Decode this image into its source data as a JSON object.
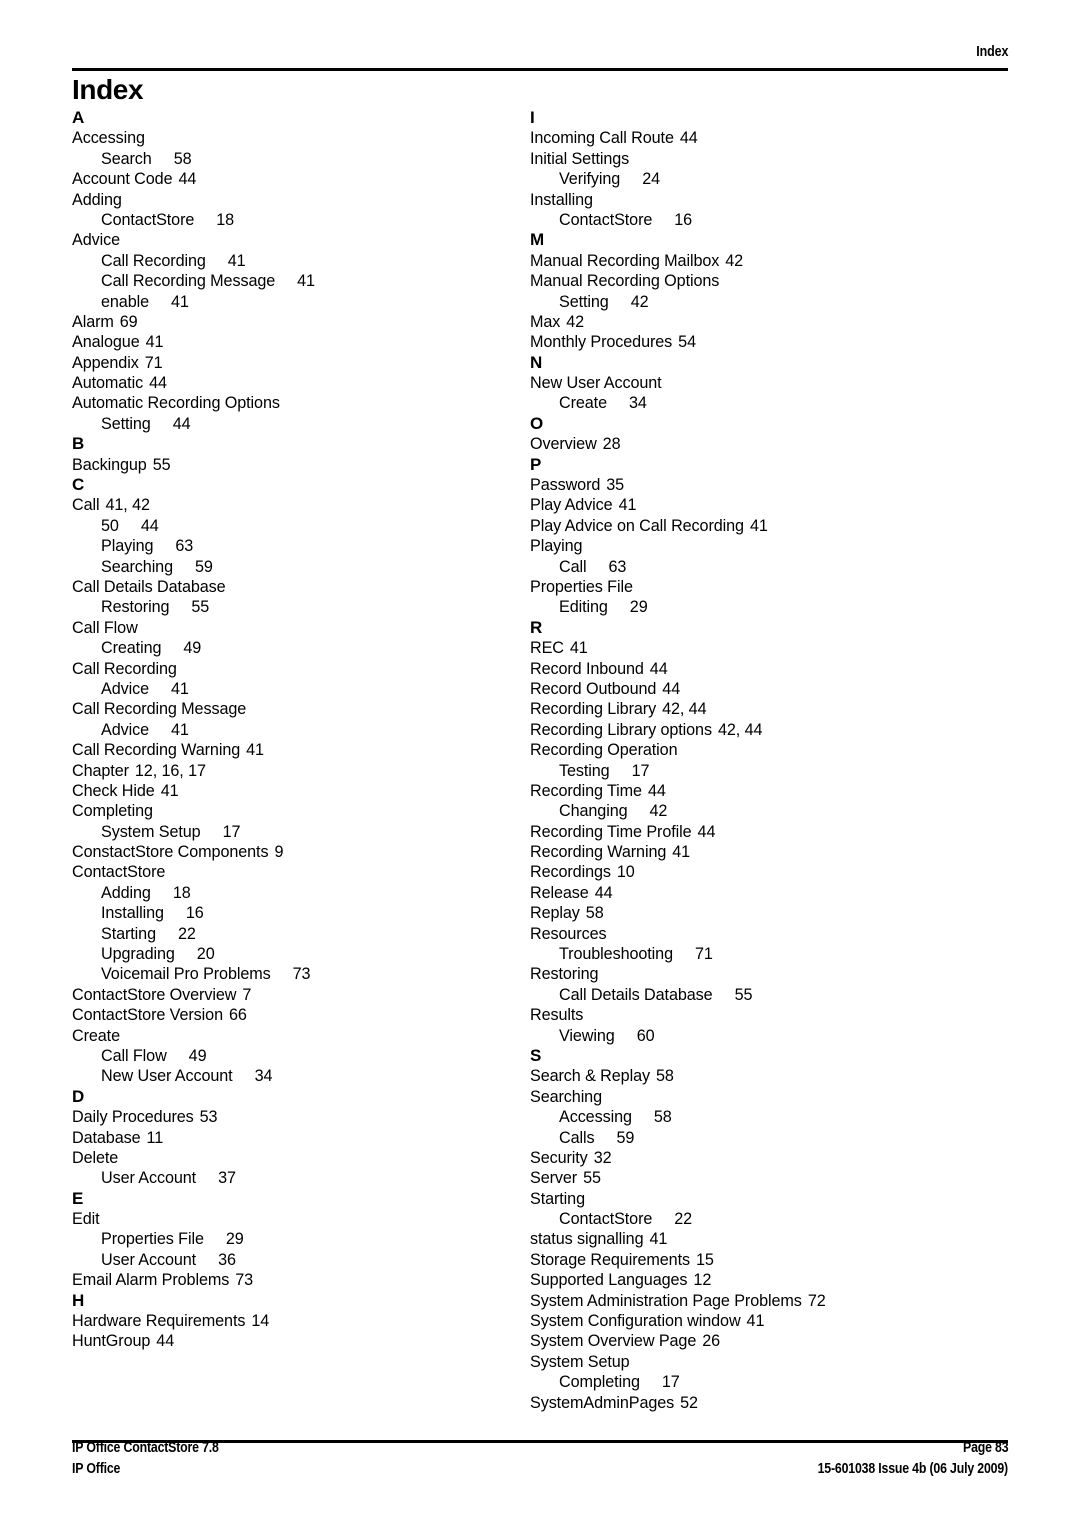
{
  "header": {
    "running_head": "Index"
  },
  "page_title": "Index",
  "index": {
    "left_column": [
      {
        "type": "letter",
        "text": "A"
      },
      {
        "type": "entry",
        "text": "Accessing",
        "page": ""
      },
      {
        "type": "sub",
        "text": "Search",
        "page": "58"
      },
      {
        "type": "entry",
        "text": "Account Code",
        "page": "44"
      },
      {
        "type": "entry",
        "text": "Adding",
        "page": ""
      },
      {
        "type": "sub",
        "text": "ContactStore",
        "page": "18"
      },
      {
        "type": "entry",
        "text": "Advice",
        "page": ""
      },
      {
        "type": "sub",
        "text": "Call Recording",
        "page": "41"
      },
      {
        "type": "sub",
        "text": "Call Recording Message",
        "page": "41"
      },
      {
        "type": "sub",
        "text": "enable",
        "page": "41"
      },
      {
        "type": "entry",
        "text": "Alarm",
        "page": "69"
      },
      {
        "type": "entry",
        "text": "Analogue",
        "page": "41"
      },
      {
        "type": "entry",
        "text": "Appendix",
        "page": "71"
      },
      {
        "type": "entry",
        "text": "Automatic",
        "page": "44"
      },
      {
        "type": "entry",
        "text": "Automatic Recording Options",
        "page": ""
      },
      {
        "type": "sub",
        "text": "Setting",
        "page": "44"
      },
      {
        "type": "letter",
        "text": "B"
      },
      {
        "type": "entry",
        "text": "Backingup",
        "page": "55"
      },
      {
        "type": "letter",
        "text": "C"
      },
      {
        "type": "entry",
        "text": "Call",
        "page": "41, 42"
      },
      {
        "type": "sub",
        "text": "50",
        "page": "44"
      },
      {
        "type": "sub",
        "text": "Playing",
        "page": "63"
      },
      {
        "type": "sub",
        "text": "Searching",
        "page": "59"
      },
      {
        "type": "entry",
        "text": "Call Details Database",
        "page": ""
      },
      {
        "type": "sub",
        "text": "Restoring",
        "page": "55"
      },
      {
        "type": "entry",
        "text": "Call Flow",
        "page": ""
      },
      {
        "type": "sub",
        "text": "Creating",
        "page": "49"
      },
      {
        "type": "entry",
        "text": "Call Recording",
        "page": ""
      },
      {
        "type": "sub",
        "text": "Advice",
        "page": "41"
      },
      {
        "type": "entry",
        "text": "Call Recording Message",
        "page": ""
      },
      {
        "type": "sub",
        "text": "Advice",
        "page": "41"
      },
      {
        "type": "entry",
        "text": "Call Recording Warning",
        "page": "41"
      },
      {
        "type": "entry",
        "text": "Chapter",
        "page": "12, 16, 17"
      },
      {
        "type": "entry",
        "text": "Check Hide",
        "page": "41"
      },
      {
        "type": "entry",
        "text": "Completing",
        "page": ""
      },
      {
        "type": "sub",
        "text": "System Setup",
        "page": "17"
      },
      {
        "type": "entry",
        "text": "ConstactStore Components",
        "page": "9"
      },
      {
        "type": "entry",
        "text": "ContactStore",
        "page": ""
      },
      {
        "type": "sub",
        "text": "Adding",
        "page": "18"
      },
      {
        "type": "sub",
        "text": "Installing",
        "page": "16"
      },
      {
        "type": "sub",
        "text": "Starting",
        "page": "22"
      },
      {
        "type": "sub",
        "text": "Upgrading",
        "page": "20"
      },
      {
        "type": "sub",
        "text": "Voicemail Pro Problems",
        "page": "73"
      },
      {
        "type": "entry",
        "text": "ContactStore Overview",
        "page": "7"
      },
      {
        "type": "entry",
        "text": "ContactStore Version",
        "page": "66"
      },
      {
        "type": "entry",
        "text": "Create",
        "page": ""
      },
      {
        "type": "sub",
        "text": "Call Flow",
        "page": "49"
      },
      {
        "type": "sub",
        "text": "New User Account",
        "page": "34"
      },
      {
        "type": "letter",
        "text": "D"
      },
      {
        "type": "entry",
        "text": "Daily Procedures",
        "page": "53"
      },
      {
        "type": "entry",
        "text": "Database",
        "page": "11"
      },
      {
        "type": "entry",
        "text": "Delete",
        "page": ""
      },
      {
        "type": "sub",
        "text": "User Account",
        "page": "37"
      },
      {
        "type": "letter",
        "text": "E"
      },
      {
        "type": "entry",
        "text": "Edit",
        "page": ""
      },
      {
        "type": "sub",
        "text": "Properties File",
        "page": "29"
      },
      {
        "type": "sub",
        "text": "User Account",
        "page": "36"
      },
      {
        "type": "entry",
        "text": "Email Alarm Problems",
        "page": "73"
      },
      {
        "type": "letter",
        "text": "H"
      },
      {
        "type": "entry",
        "text": "Hardware Requirements",
        "page": "14"
      },
      {
        "type": "entry",
        "text": "HuntGroup",
        "page": "44"
      }
    ],
    "right_column": [
      {
        "type": "letter",
        "text": "I"
      },
      {
        "type": "entry",
        "text": "Incoming Call Route",
        "page": "44"
      },
      {
        "type": "entry",
        "text": "Initial Settings",
        "page": ""
      },
      {
        "type": "sub",
        "text": "Verifying",
        "page": "24"
      },
      {
        "type": "entry",
        "text": "Installing",
        "page": ""
      },
      {
        "type": "sub",
        "text": "ContactStore",
        "page": "16"
      },
      {
        "type": "letter",
        "text": "M"
      },
      {
        "type": "entry",
        "text": "Manual Recording Mailbox",
        "page": "42"
      },
      {
        "type": "entry",
        "text": "Manual Recording Options",
        "page": ""
      },
      {
        "type": "sub",
        "text": "Setting",
        "page": "42"
      },
      {
        "type": "entry",
        "text": "Max",
        "page": "42"
      },
      {
        "type": "entry",
        "text": "Monthly Procedures",
        "page": "54"
      },
      {
        "type": "letter",
        "text": "N"
      },
      {
        "type": "entry",
        "text": "New User Account",
        "page": ""
      },
      {
        "type": "sub",
        "text": "Create",
        "page": "34"
      },
      {
        "type": "letter",
        "text": "O"
      },
      {
        "type": "entry",
        "text": "Overview",
        "page": "28"
      },
      {
        "type": "letter",
        "text": "P"
      },
      {
        "type": "entry",
        "text": "Password",
        "page": "35"
      },
      {
        "type": "entry",
        "text": "Play Advice",
        "page": "41"
      },
      {
        "type": "entry",
        "text": "Play Advice on Call Recording",
        "page": "41"
      },
      {
        "type": "entry",
        "text": "Playing",
        "page": ""
      },
      {
        "type": "sub",
        "text": "Call",
        "page": "63"
      },
      {
        "type": "entry",
        "text": "Properties File",
        "page": ""
      },
      {
        "type": "sub",
        "text": "Editing",
        "page": "29"
      },
      {
        "type": "letter",
        "text": "R"
      },
      {
        "type": "entry",
        "text": "REC",
        "page": "41"
      },
      {
        "type": "entry",
        "text": "Record Inbound",
        "page": "44"
      },
      {
        "type": "entry",
        "text": "Record Outbound",
        "page": "44"
      },
      {
        "type": "entry",
        "text": "Recording Library",
        "page": "42, 44"
      },
      {
        "type": "entry",
        "text": "Recording Library options",
        "page": "42, 44"
      },
      {
        "type": "entry",
        "text": "Recording Operation",
        "page": ""
      },
      {
        "type": "sub",
        "text": "Testing",
        "page": "17"
      },
      {
        "type": "entry",
        "text": "Recording Time",
        "page": "44"
      },
      {
        "type": "sub",
        "text": "Changing",
        "page": "42"
      },
      {
        "type": "entry",
        "text": "Recording Time Profile",
        "page": "44"
      },
      {
        "type": "entry",
        "text": "Recording Warning",
        "page": "41"
      },
      {
        "type": "entry",
        "text": "Recordings",
        "page": "10"
      },
      {
        "type": "entry",
        "text": "Release",
        "page": "44"
      },
      {
        "type": "entry",
        "text": "Replay",
        "page": "58"
      },
      {
        "type": "entry",
        "text": "Resources",
        "page": ""
      },
      {
        "type": "sub",
        "text": "Troubleshooting",
        "page": "71"
      },
      {
        "type": "entry",
        "text": "Restoring",
        "page": ""
      },
      {
        "type": "sub",
        "text": "Call Details Database",
        "page": "55"
      },
      {
        "type": "entry",
        "text": "Results",
        "page": ""
      },
      {
        "type": "sub",
        "text": "Viewing",
        "page": "60"
      },
      {
        "type": "letter",
        "text": "S"
      },
      {
        "type": "entry",
        "text": "Search & Replay",
        "page": "58"
      },
      {
        "type": "entry",
        "text": "Searching",
        "page": ""
      },
      {
        "type": "sub",
        "text": "Accessing",
        "page": "58"
      },
      {
        "type": "sub",
        "text": "Calls",
        "page": "59"
      },
      {
        "type": "entry",
        "text": "Security",
        "page": "32"
      },
      {
        "type": "entry",
        "text": "Server",
        "page": "55"
      },
      {
        "type": "entry",
        "text": "Starting",
        "page": ""
      },
      {
        "type": "sub",
        "text": "ContactStore",
        "page": "22"
      },
      {
        "type": "entry",
        "text": "status signalling",
        "page": "41"
      },
      {
        "type": "entry",
        "text": "Storage Requirements",
        "page": "15"
      },
      {
        "type": "entry",
        "text": "Supported Languages",
        "page": "12"
      },
      {
        "type": "entry",
        "text": "System Administration Page Problems",
        "page": "72"
      },
      {
        "type": "entry",
        "text": "System Configuration window",
        "page": "41"
      },
      {
        "type": "entry",
        "text": "System Overview Page",
        "page": "26"
      },
      {
        "type": "entry",
        "text": "System Setup",
        "page": ""
      },
      {
        "type": "sub",
        "text": "Completing",
        "page": "17"
      },
      {
        "type": "entry",
        "text": "SystemAdminPages",
        "page": "52"
      }
    ]
  },
  "footer": {
    "left_line1": "IP Office ContactStore 7.8",
    "left_line2": "IP Office",
    "right_line1": "Page 83",
    "right_line2": "15-601038 Issue 4b (06 July 2009)"
  }
}
